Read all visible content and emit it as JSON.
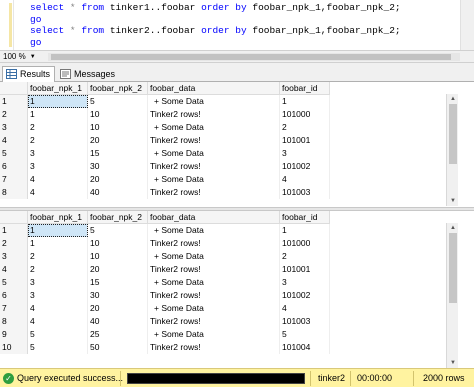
{
  "editor": {
    "lines": [
      {
        "kw1": "select",
        "star": "*",
        "kw2": "from",
        "rest": "tinker1..foobar",
        "kw3": "order by",
        "cols": "foobar_npk_1,foobar_npk_2;"
      },
      {
        "go": "go"
      },
      {
        "kw1": "select",
        "star": "*",
        "kw2": "from",
        "rest": "tinker2..foobar",
        "kw3": "order by",
        "cols": "foobar_npk_1,foobar_npk_2;"
      },
      {
        "go": "go"
      }
    ],
    "zoom": "100 %"
  },
  "tabs": [
    {
      "label": "Results",
      "icon": "grid-icon"
    },
    {
      "label": "Messages",
      "icon": "messages-icon"
    }
  ],
  "grid1": {
    "columns": [
      "foobar_npk_1",
      "foobar_npk_2",
      "foobar_data",
      "foobar_id"
    ],
    "rows": [
      [
        "1",
        "1",
        "5",
        "+ Some Data",
        "1"
      ],
      [
        "2",
        "1",
        "10",
        "Tinker2 rows!",
        "101000"
      ],
      [
        "3",
        "2",
        "10",
        "+ Some Data",
        "2"
      ],
      [
        "4",
        "2",
        "20",
        "Tinker2 rows!",
        "101001"
      ],
      [
        "5",
        "3",
        "15",
        "+ Some Data",
        "3"
      ],
      [
        "6",
        "3",
        "30",
        "Tinker2 rows!",
        "101002"
      ],
      [
        "7",
        "4",
        "20",
        "+ Some Data",
        "4"
      ],
      [
        "8",
        "4",
        "40",
        "Tinker2 rows!",
        "101003"
      ]
    ]
  },
  "grid2": {
    "columns": [
      "foobar_npk_1",
      "foobar_npk_2",
      "foobar_data",
      "foobar_id"
    ],
    "rows": [
      [
        "1",
        "1",
        "5",
        "+ Some Data",
        "1"
      ],
      [
        "2",
        "1",
        "10",
        "Tinker2 rows!",
        "101000"
      ],
      [
        "3",
        "2",
        "10",
        "+ Some Data",
        "2"
      ],
      [
        "4",
        "2",
        "20",
        "Tinker2 rows!",
        "101001"
      ],
      [
        "5",
        "3",
        "15",
        "+ Some Data",
        "3"
      ],
      [
        "6",
        "3",
        "30",
        "Tinker2 rows!",
        "101002"
      ],
      [
        "7",
        "4",
        "20",
        "+ Some Data",
        "4"
      ],
      [
        "8",
        "4",
        "40",
        "Tinker2 rows!",
        "101003"
      ],
      [
        "9",
        "5",
        "25",
        "+ Some Data",
        "5"
      ],
      [
        "10",
        "5",
        "50",
        "Tinker2 rows!",
        "101004"
      ]
    ]
  },
  "status": {
    "message": "Query executed success...",
    "database": "tinker2",
    "elapsed": "00:00:00",
    "rows": "2000 rows",
    "ok_icon": "check-circle-icon"
  }
}
